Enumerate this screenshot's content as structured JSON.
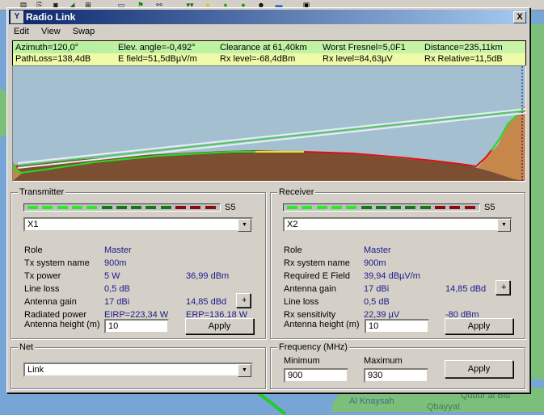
{
  "window": {
    "title": "Radio Link",
    "title_icon": "antenna-icon",
    "close_label": "X"
  },
  "menu": [
    "Edit",
    "View",
    "Swap"
  ],
  "info": {
    "row1": [
      "Azimuth=120,0°",
      "Elev. angle=-0,492°",
      "Clearance at 61,40km",
      "Worst Fresnel=5,0F1",
      "Distance=235,11km"
    ],
    "row2": [
      "PathLoss=138,4dB",
      "E field=51,5dBµV/m",
      "Rx level=-68,4dBm",
      "Rx level=84,63µV",
      "Rx Relative=11,5dB"
    ]
  },
  "profile": {
    "colors": {
      "sky": "#a3bfd0",
      "ground": "#7d4f32",
      "ground_near": "#c8874a",
      "path_ok": "#22dd22",
      "path_obstructed": "#dd1111",
      "path_warning": "#f0e020",
      "fresnel": "#e8eef4",
      "beam": "#44cc44"
    }
  },
  "transmitter": {
    "legend": "Transmitter",
    "meter_label": "S5",
    "meter_level": "5 of 13 bright segments (S5)",
    "selected": "X1",
    "rows": [
      {
        "label": "Role",
        "value": "Master",
        "value2": ""
      },
      {
        "label": "Tx system name",
        "value": "900m",
        "value2": ""
      },
      {
        "label": "Tx power",
        "value": "5 W",
        "value2": "36,99 dBm"
      },
      {
        "label": "Line loss",
        "value": "0,5 dB",
        "value2": ""
      },
      {
        "label": "Antenna gain",
        "value": "17 dBi",
        "value2": "14,85 dBd"
      },
      {
        "label": "Radiated power",
        "value": "EIRP=223,34 W",
        "value2": "ERP=136,18 W"
      }
    ],
    "antenna_height_label": "Antenna height (m)",
    "antenna_height": "10",
    "apply_label": "Apply",
    "plus_label": "+"
  },
  "receiver": {
    "legend": "Receiver",
    "meter_label": "S5",
    "selected": "X2",
    "rows": [
      {
        "label": "Role",
        "value": "Master",
        "value2": ""
      },
      {
        "label": "Rx system name",
        "value": "900m",
        "value2": ""
      },
      {
        "label": "Required E Field",
        "value": "39,94 dBµV/m",
        "value2": ""
      },
      {
        "label": "Antenna gain",
        "value": "17 dBi",
        "value2": "14,85 dBd"
      },
      {
        "label": "Line loss",
        "value": "0,5 dB",
        "value2": ""
      },
      {
        "label": "Rx sensitivity",
        "value": "22,39 µV",
        "value2": "-80 dBm"
      }
    ],
    "antenna_height_label": "Antenna height (m)",
    "antenna_height": "10",
    "apply_label": "Apply",
    "plus_label": "+"
  },
  "net": {
    "legend": "Net",
    "selected": "Link"
  },
  "frequency": {
    "legend": "Frequency (MHz)",
    "min_label": "Minimum",
    "max_label": "Maximum",
    "min": "900",
    "max": "930",
    "apply_label": "Apply"
  },
  "map": {
    "labels": [
      "Al Knaysah",
      "Qbayyat",
      "Qubur al Bid"
    ]
  },
  "meter_colors": {
    "bright": "#22ee22",
    "dark": "#137a13",
    "red": "#8b0a0a"
  }
}
